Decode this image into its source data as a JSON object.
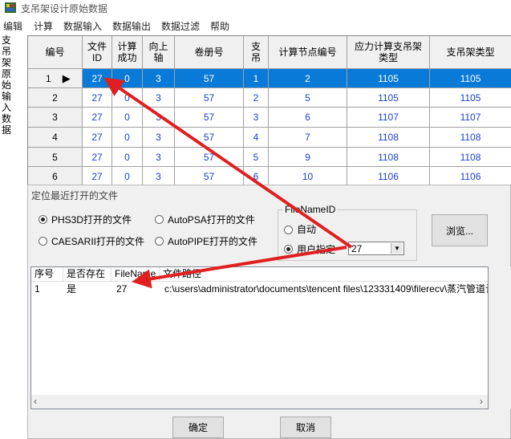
{
  "window": {
    "title": "支吊架设计原始数据"
  },
  "menu": {
    "items": [
      "编辑",
      "计算",
      "数据输入",
      "数据输出",
      "数据过滤",
      "帮助"
    ]
  },
  "side_label": "支吊架原始输入数据",
  "grid": {
    "headers": {
      "c0": "编号",
      "c1": "文件ID",
      "c2": "计算成功",
      "c3": "向上轴",
      "c4": "卷册号",
      "c5": "支吊",
      "c6": "计算节点编号",
      "c7": "应力计算支吊架类型",
      "c8": "支吊架类型"
    },
    "rows": [
      {
        "no": "1",
        "marker": "▶",
        "file_id": "27",
        "calc_ok": "0",
        "up_axis": "3",
        "volume": "57",
        "support": "1",
        "node": "2",
        "stress_type": "1105",
        "type": "1105"
      },
      {
        "no": "2",
        "marker": "",
        "file_id": "27",
        "calc_ok": "0",
        "up_axis": "3",
        "volume": "57",
        "support": "2",
        "node": "5",
        "stress_type": "1105",
        "type": "1105"
      },
      {
        "no": "3",
        "marker": "",
        "file_id": "27",
        "calc_ok": "0",
        "up_axis": "3",
        "volume": "57",
        "support": "3",
        "node": "6",
        "stress_type": "1107",
        "type": "1107"
      },
      {
        "no": "4",
        "marker": "",
        "file_id": "27",
        "calc_ok": "0",
        "up_axis": "3",
        "volume": "57",
        "support": "4",
        "node": "7",
        "stress_type": "1108",
        "type": "1108"
      },
      {
        "no": "5",
        "marker": "",
        "file_id": "27",
        "calc_ok": "0",
        "up_axis": "3",
        "volume": "57",
        "support": "5",
        "node": "9",
        "stress_type": "1108",
        "type": "1108"
      },
      {
        "no": "6",
        "marker": "",
        "file_id": "27",
        "calc_ok": "0",
        "up_axis": "3",
        "volume": "57",
        "support": "6",
        "node": "10",
        "stress_type": "1106",
        "type": "1106"
      }
    ]
  },
  "dialog": {
    "title": "定位最近打开的文件",
    "options": {
      "phs3d": "PHS3D打开的文件",
      "autopsa": "AutoPSA打开的文件",
      "caesar": "CAESARII打开的文件",
      "autopipe": "AutoPIPE打开的文件",
      "selected": "PHS3D打开的文件"
    },
    "filename_id": {
      "group_title": "FileNameID",
      "auto_label": "自动",
      "user_label": "用户指定",
      "selected": "用户指定",
      "value": "27"
    },
    "browse_label": "浏览...",
    "list": {
      "headers": {
        "no": "序号",
        "exists": "是否存在",
        "filename": "FileName",
        "path": "文件路径"
      },
      "rows": [
        {
          "no": "1",
          "exists": "是",
          "filename": "27",
          "path": "c:\\users\\administrator\\documents\\tencent files\\123331409\\filerecv\\蒸汽管道计算模型"
        }
      ]
    },
    "ok_label": "确定",
    "cancel_label": "取消"
  },
  "colors": {
    "selection": "#0a7ad8",
    "grid_value": "#1a3fd1",
    "annotation_arrow": "#e02020",
    "dialog_bg": "#f0f0f0"
  }
}
